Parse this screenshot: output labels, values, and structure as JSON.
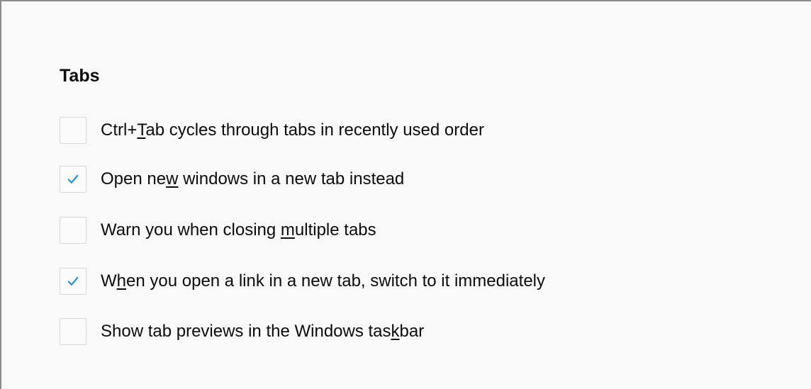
{
  "section": {
    "title": "Tabs"
  },
  "options": [
    {
      "pre": "Ctrl+",
      "key": "T",
      "post": "ab cycles through tabs in recently used order",
      "checked": false
    },
    {
      "pre": "Open ne",
      "key": "w",
      "post": " windows in a new tab instead",
      "checked": true
    },
    {
      "pre": "Warn you when closing ",
      "key": "m",
      "post": "ultiple tabs",
      "checked": false
    },
    {
      "pre": "W",
      "key": "h",
      "post": "en you open a link in a new tab, switch to it immediately",
      "checked": true
    },
    {
      "pre": "Show tab previews in the Windows tas",
      "key": "k",
      "post": "bar",
      "checked": false
    }
  ],
  "colors": {
    "checkmark": "#2b91d6",
    "background": "#f9f9fa",
    "text": "#0c0c0d",
    "checkbox_border": "#d7d7db"
  }
}
